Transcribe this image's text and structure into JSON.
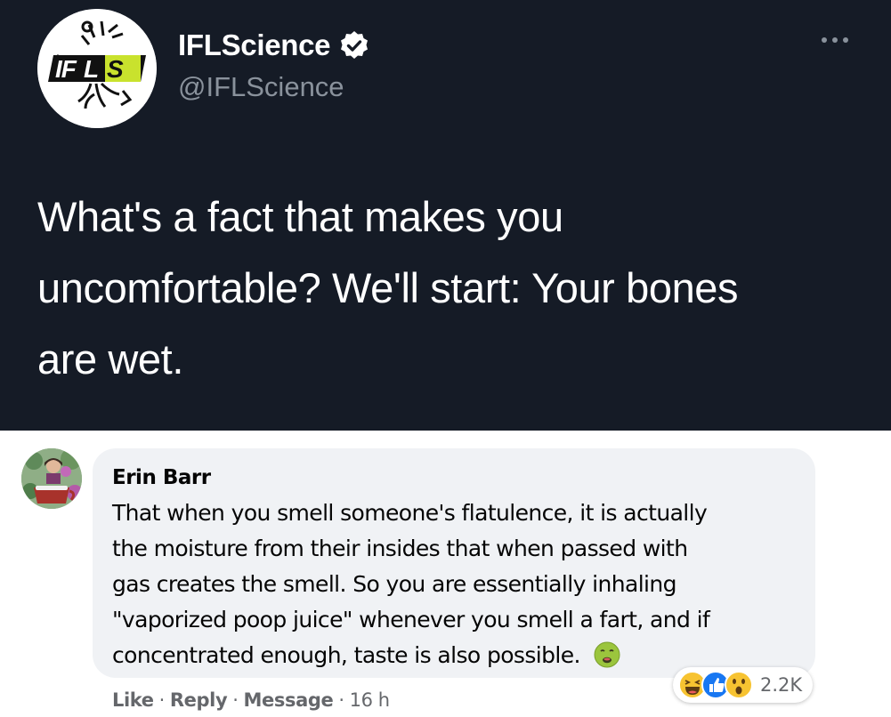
{
  "tweet": {
    "display_name": "IFLScience",
    "handle": "@IFLScience",
    "logo_text": "IFLS",
    "text_lines": [
      "What's a fact that makes you",
      "uncomfortable? We'll start: Your bones",
      "are wet."
    ],
    "background_color": "#151b26",
    "verified_icon": "verified-badge-icon",
    "more_icon": "more-options-icon"
  },
  "comment": {
    "author": "Erin Barr",
    "lines": [
      "That when you smell someone's flatulence, it is actually",
      "the moisture from their insides that when passed with",
      "gas creates the smell. So you are essentially inhaling",
      "\"vaporized poop juice\" whenever you smell a fart, and if",
      "concentrated enough, taste is also possible."
    ],
    "emoji": "nauseated-face-icon",
    "reactions": {
      "icons": [
        "laugh-reaction-icon",
        "like-reaction-icon",
        "wow-reaction-icon"
      ],
      "count": "2.2K"
    },
    "actions": {
      "like": "Like",
      "reply": "Reply",
      "message": "Message",
      "separator": "·",
      "time": "16 h"
    },
    "bubble_color": "#f0f2f5"
  }
}
